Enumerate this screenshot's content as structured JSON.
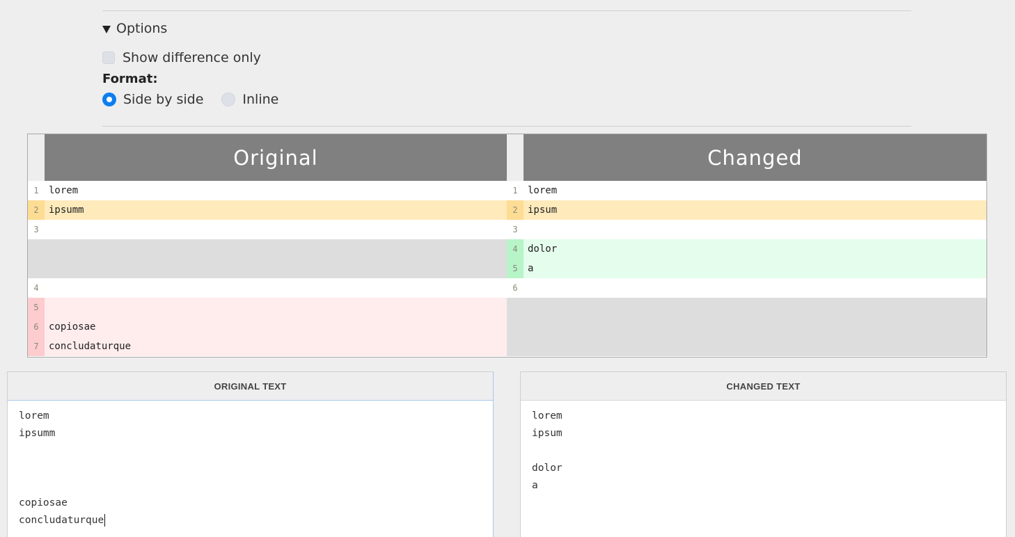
{
  "options": {
    "summary_label": "Options",
    "show_difference_only_label": "Show difference only",
    "show_difference_only_checked": false,
    "format_label": "Format:",
    "format_options": [
      {
        "label": "Side by side",
        "selected": true
      },
      {
        "label": "Inline",
        "selected": false
      }
    ]
  },
  "diff": {
    "left_title": "Original",
    "right_title": "Changed",
    "rows": [
      {
        "type": "normal",
        "left_ln": "1",
        "left_text": "lorem",
        "right_ln": "1",
        "right_text": "lorem"
      },
      {
        "type": "mod",
        "left_ln": "2",
        "left_text": "ipsumm",
        "right_ln": "2",
        "right_text": "ipsum"
      },
      {
        "type": "normal",
        "left_ln": "3",
        "left_text": "",
        "right_ln": "3",
        "right_text": ""
      },
      {
        "type": "add",
        "left_ln": "",
        "left_text": "",
        "right_ln": "4",
        "right_text": "dolor"
      },
      {
        "type": "add",
        "left_ln": "",
        "left_text": "",
        "right_ln": "5",
        "right_text": "a"
      },
      {
        "type": "normal",
        "left_ln": "4",
        "left_text": "",
        "right_ln": "6",
        "right_text": ""
      },
      {
        "type": "del",
        "left_ln": "5",
        "left_text": "",
        "right_ln": "",
        "right_text": ""
      },
      {
        "type": "del",
        "left_ln": "6",
        "left_text": "copiosae",
        "right_ln": "",
        "right_text": ""
      },
      {
        "type": "del",
        "left_ln": "7",
        "left_text": "concludaturque",
        "right_ln": "",
        "right_text": ""
      }
    ]
  },
  "original_panel": {
    "header": "ORIGINAL TEXT",
    "lines": [
      "lorem",
      "ipsumm",
      "",
      "",
      "",
      "copiosae",
      "concludaturque"
    ]
  },
  "changed_panel": {
    "header": "CHANGED TEXT",
    "lines": [
      "lorem",
      "ipsum",
      "",
      "dolor",
      "a"
    ]
  },
  "colors": {
    "modified_bg": "#ffeabb",
    "added_bg": "#e5fdec",
    "deleted_bg": "#ffeced",
    "empty_bg": "#dddddd",
    "header_bg": "#808080",
    "radio_accent": "#0d7ef0"
  }
}
